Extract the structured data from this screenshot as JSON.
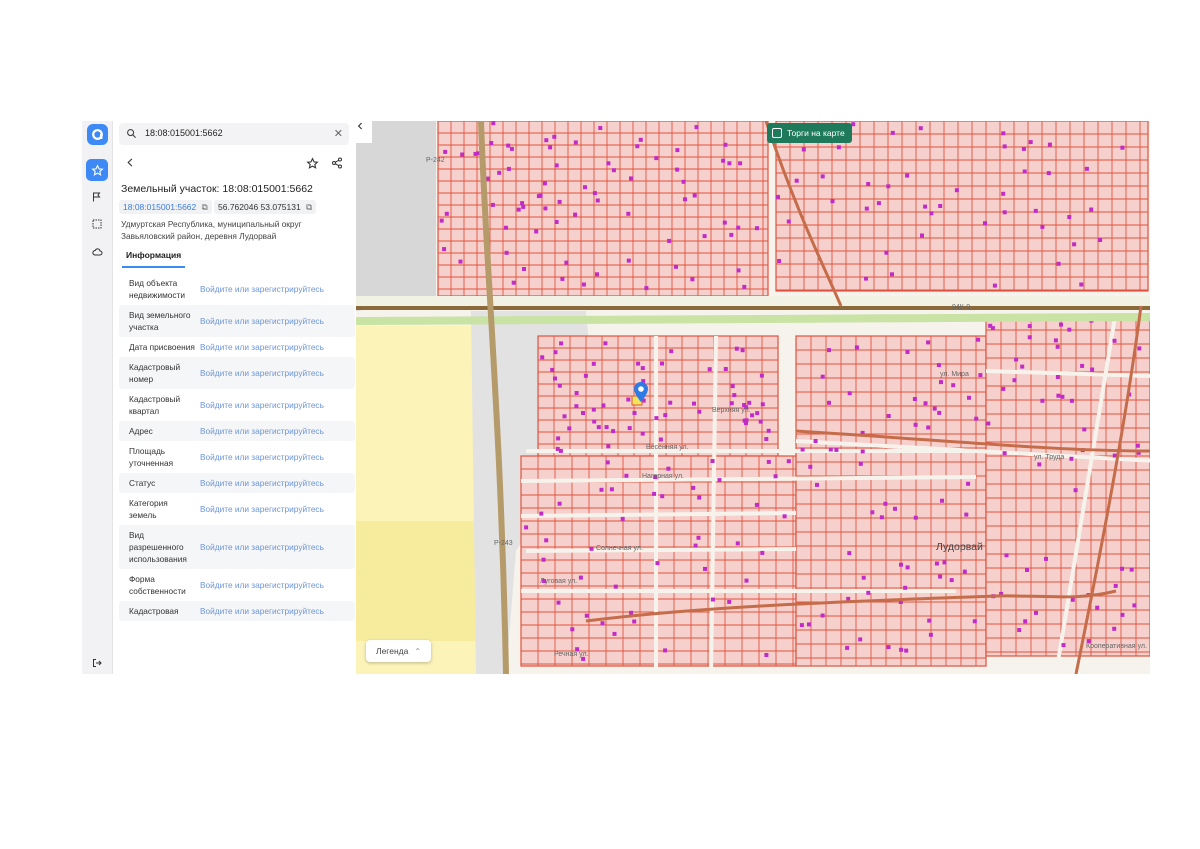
{
  "rail": {
    "icons": [
      "logo-icon",
      "star-icon",
      "flag-icon",
      "select-area-icon",
      "cloud-icon",
      "logout-icon"
    ]
  },
  "search": {
    "query": "18:08:015001:5662"
  },
  "panel": {
    "title": "Земельный участок: 18:08:015001:5662",
    "cadastral_number": "18:08:015001:5662",
    "coordinates": "56.762046 53.075131",
    "address": "Удмуртская Республика, муниципальный округ Завьяловский район, деревня Лудорвай",
    "tab": "Информация",
    "rows": [
      {
        "label": "Вид объекта недвижимости",
        "value": "Войдите или зарегистрируйтесь"
      },
      {
        "label": "Вид земельного участка",
        "value": "Войдите или зарегистрируйтесь"
      },
      {
        "label": "Дата присвоения",
        "value": "Войдите или зарегистрируйтесь"
      },
      {
        "label": "Кадастровый номер",
        "value": "Войдите или зарегистрируйтесь"
      },
      {
        "label": "Кадастровый квартал",
        "value": "Войдите или зарегистрируйтесь"
      },
      {
        "label": "Адрес",
        "value": "Войдите или зарегистрируйтесь"
      },
      {
        "label": "Площадь уточненная",
        "value": "Войдите или зарегистрируйтесь"
      },
      {
        "label": "Статус",
        "value": "Войдите или зарегистрируйтесь"
      },
      {
        "label": "Категория земель",
        "value": "Войдите или зарегистрируйтесь"
      },
      {
        "label": "Вид разрешенного использования",
        "value": "Войдите или зарегистрируйтесь"
      },
      {
        "label": "Форма собственности",
        "value": "Войдите или зарегистрируйтесь"
      },
      {
        "label": "Кадастровая",
        "value": "Войдите или зарегистрируйтесь"
      }
    ]
  },
  "map": {
    "torgi_label": "Торги на карте",
    "legend_label": "Легенда",
    "town_label": "Лудорвай",
    "streets": [
      "Весенняя ул.",
      "Нагорная ул.",
      "Солнечная ул.",
      "Луговая ул.",
      "Речная ул.",
      "Верхняя ул.",
      "ул. Мира",
      "ул. Труда",
      "Кооперативная ул."
    ],
    "roads": [
      "Р-242",
      "Р-243",
      "94К-9"
    ]
  },
  "colors": {
    "accent": "#3d8af7",
    "parcel": "#e0533e",
    "parcel_fill": "#f6d0cc",
    "torgi_bg": "#1f7a5c",
    "link": "#6d95d8"
  }
}
